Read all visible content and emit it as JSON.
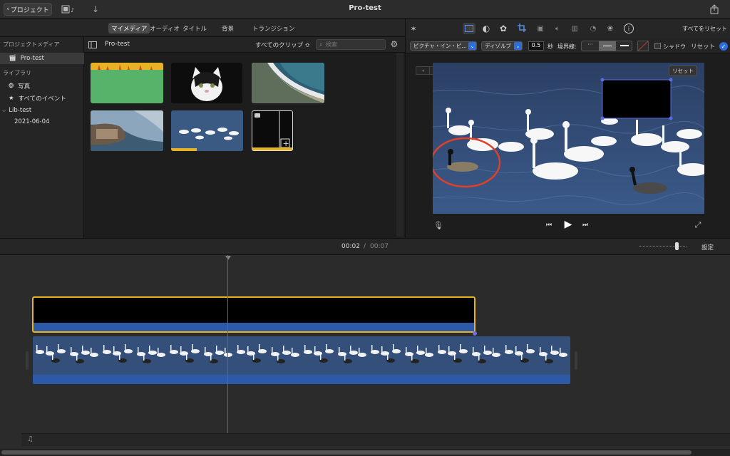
{
  "titlebar": {
    "back_label": "プロジェクト",
    "title": "Pro-test"
  },
  "browser_tabs": [
    "マイメディア",
    "オーディオ",
    "タイトル",
    "背景",
    "トランジション"
  ],
  "sidebar": {
    "section_project": "プロジェクトメディア",
    "project_item": "Pro-test",
    "section_library": "ライブラリ",
    "photos": "写真",
    "all_events": "すべてのイベント",
    "lib": "Lib-test",
    "date": "2021-06-04"
  },
  "browser": {
    "title": "Pro-test",
    "filter": "すべてのクリップ ≎",
    "search_placeholder": "検索"
  },
  "viewer_toolbar": {
    "reset_all": "すべてをリセット"
  },
  "adjust_bar": {
    "mode": "ピクチャ・イン・ピ…",
    "transition": "ディゾルブ",
    "duration": "0.5",
    "seconds": "秒",
    "border_label": "境界線:",
    "shadow": "シャドウ",
    "reset": "リセット"
  },
  "viewer": {
    "reset": "リセット"
  },
  "timeline_head": {
    "current": "00:02",
    "separator": "/",
    "total": "00:07",
    "settings": "設定"
  },
  "colors": {
    "accent": "#2f6ed8",
    "selection_yellow": "#e6b325",
    "clip_blue": "#2c5aa8",
    "annotation_red": "#e0402a"
  }
}
